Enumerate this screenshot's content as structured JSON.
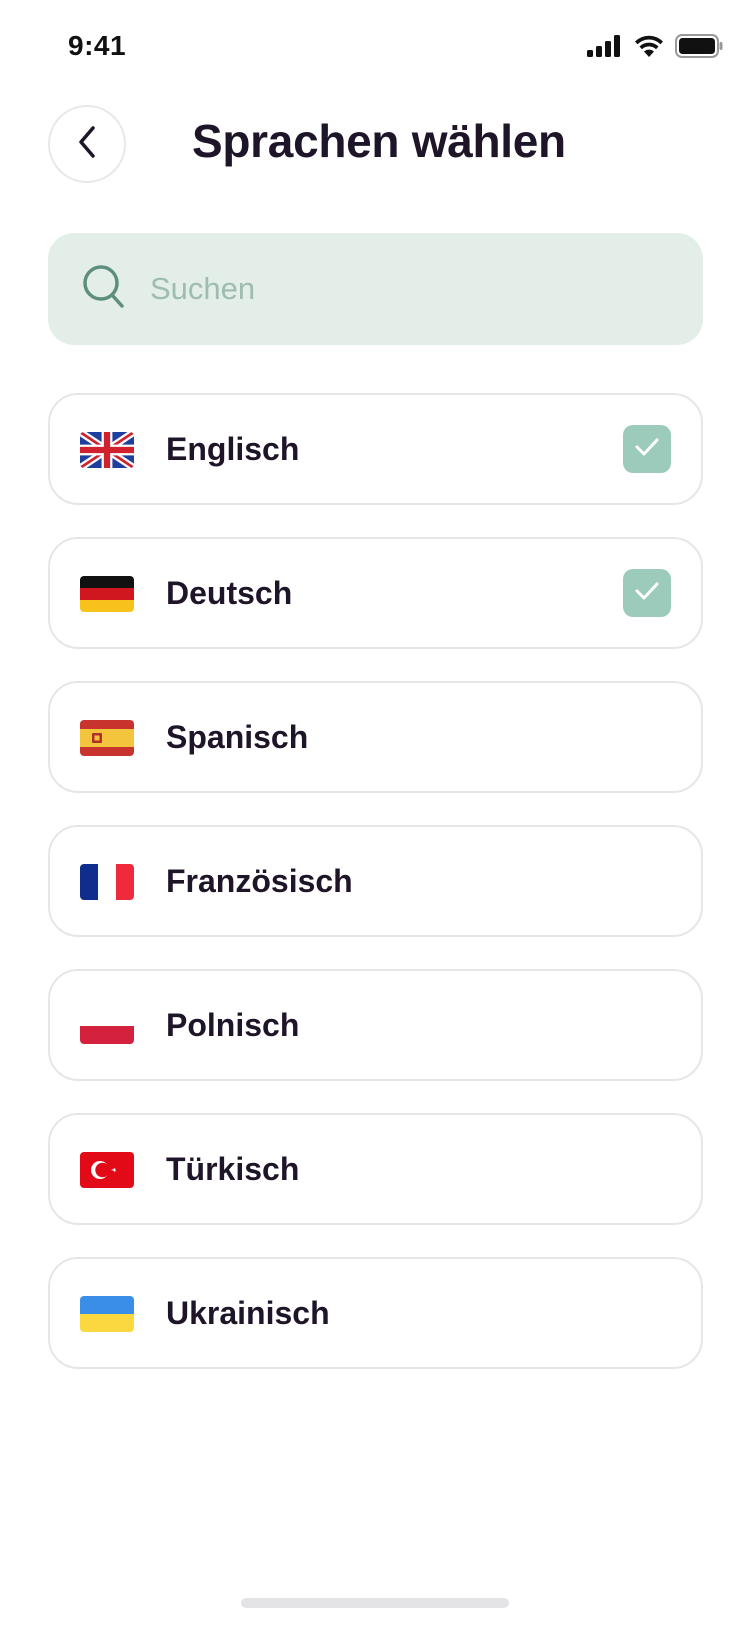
{
  "status_bar": {
    "time": "9:41"
  },
  "header": {
    "title": "Sprachen wählen"
  },
  "search": {
    "placeholder": "Suchen",
    "value": ""
  },
  "languages": [
    {
      "label": "Englisch",
      "flag": "uk-flag",
      "selected": true
    },
    {
      "label": "Deutsch",
      "flag": "germany-flag",
      "selected": true
    },
    {
      "label": "Spanisch",
      "flag": "spain-flag",
      "selected": false
    },
    {
      "label": "Französisch",
      "flag": "france-flag",
      "selected": false
    },
    {
      "label": "Polnisch",
      "flag": "poland-flag",
      "selected": false
    },
    {
      "label": "Türkisch",
      "flag": "turkey-flag",
      "selected": false
    },
    {
      "label": "Ukrainisch",
      "flag": "ukraine-flag",
      "selected": false
    }
  ],
  "colors": {
    "accent": "#9ccbbb",
    "search_bg": "#e3eee9",
    "title": "#1f1529"
  }
}
